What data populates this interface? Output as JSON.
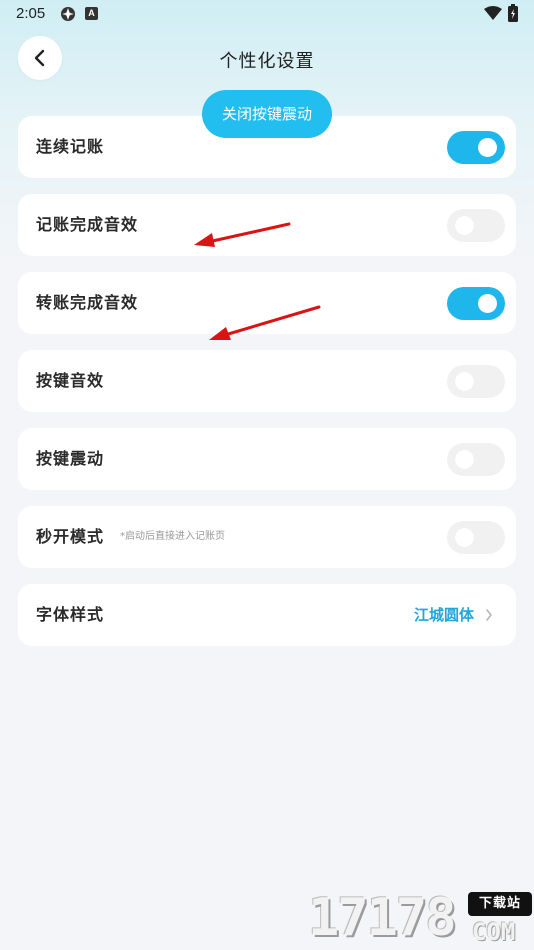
{
  "status_bar": {
    "time": "2:05",
    "icons": [
      "app-icon",
      "accessibility-icon",
      "wifi-icon",
      "battery-icon"
    ],
    "badge_letter": "A"
  },
  "header": {
    "title": "个性化设置",
    "back_icon": "chevron-left-icon"
  },
  "toast": {
    "text": "关闭按键震动"
  },
  "settings": [
    {
      "label": "连续记账",
      "on": true
    },
    {
      "label": "记账完成音效",
      "on": false
    },
    {
      "label": "转账完成音效",
      "on": true
    },
    {
      "label": "按键音效",
      "on": false
    },
    {
      "label": "按键震动",
      "on": false
    },
    {
      "label": "秒开模式",
      "hint": "*启动后直接进入记账页",
      "on": false
    }
  ],
  "font_style": {
    "label": "字体样式",
    "value": "江城圆体",
    "chevron_icon": "chevron-right-icon"
  },
  "annotations": {
    "arrow_color": "#d81414"
  },
  "watermark": {
    "digits": "17178",
    "badge": "下载站",
    "suffix": "COM"
  },
  "colors": {
    "accent": "#1fb6ec",
    "toast": "#22bef0",
    "value_text": "#20a6dc"
  }
}
